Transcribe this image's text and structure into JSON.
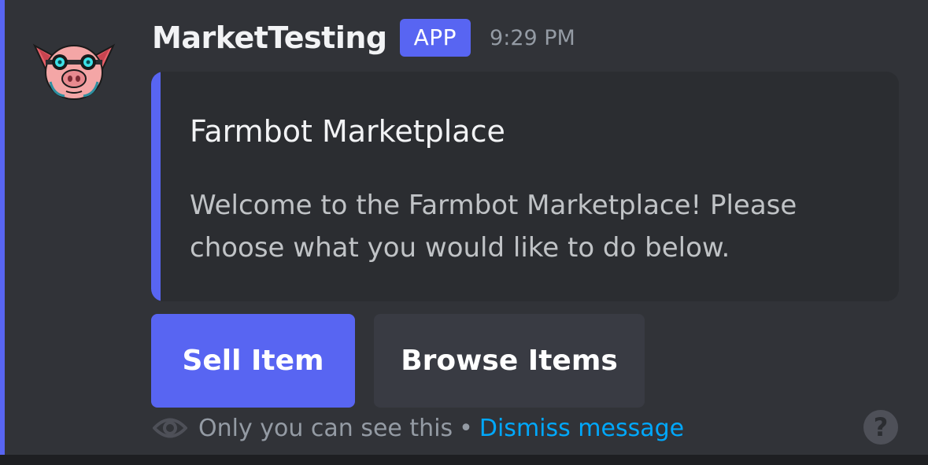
{
  "message": {
    "author": "MarketTesting",
    "badge": "APP",
    "timestamp": "9:29 PM",
    "avatar_icon": "pig-avatar-icon"
  },
  "embed": {
    "title": "Farmbot Marketplace",
    "description": "Welcome to the Farmbot Marketplace!  Please choose what you would like to do below.",
    "accent_color": "#5865f2"
  },
  "buttons": {
    "sell_label": "Sell Item",
    "browse_label": "Browse Items"
  },
  "ephemeral": {
    "notice": "Only you can see this",
    "separator": "•",
    "dismiss_label": "Dismiss message",
    "icon": "eye-icon"
  },
  "help": {
    "label": "?",
    "icon": "help-icon"
  },
  "colors": {
    "brand": "#5865f2",
    "link": "#00a8fc",
    "background": "#313338"
  }
}
